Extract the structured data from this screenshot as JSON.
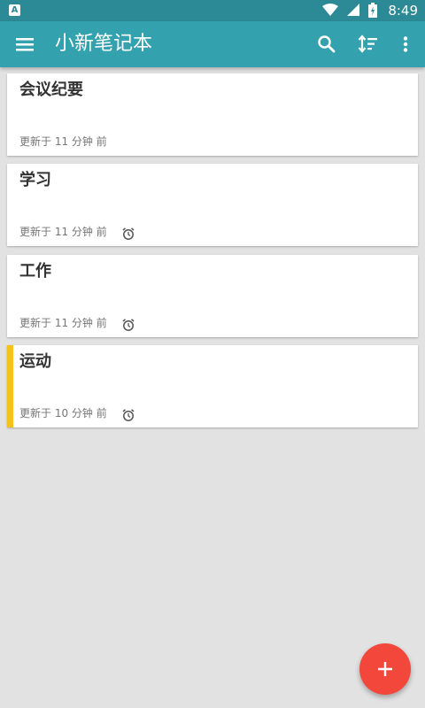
{
  "status_bar": {
    "notification_icon": "A",
    "time": "8:49"
  },
  "app_bar": {
    "title": "小新笔记本",
    "menu_icon": "menu-icon",
    "actions": [
      "search-icon",
      "sort-icon",
      "more-vert-icon"
    ]
  },
  "notes": [
    {
      "title": "会议纪要",
      "updated": "更新于 11 分钟 前",
      "has_alarm": false,
      "marked": false
    },
    {
      "title": "学习",
      "updated": "更新于 11 分钟 前",
      "has_alarm": true,
      "marked": false
    },
    {
      "title": "工作",
      "updated": "更新于 11 分钟 前",
      "has_alarm": true,
      "marked": false
    },
    {
      "title": "运动",
      "updated": "更新于 10 分钟 前",
      "has_alarm": true,
      "marked": true
    }
  ],
  "fab": {
    "icon": "add-icon"
  },
  "colors": {
    "status_bar": "#2c8a96",
    "app_bar": "#34a2ae",
    "background": "#e2e2e2",
    "marker": "#f7c11c",
    "fab": "#f3473b"
  }
}
